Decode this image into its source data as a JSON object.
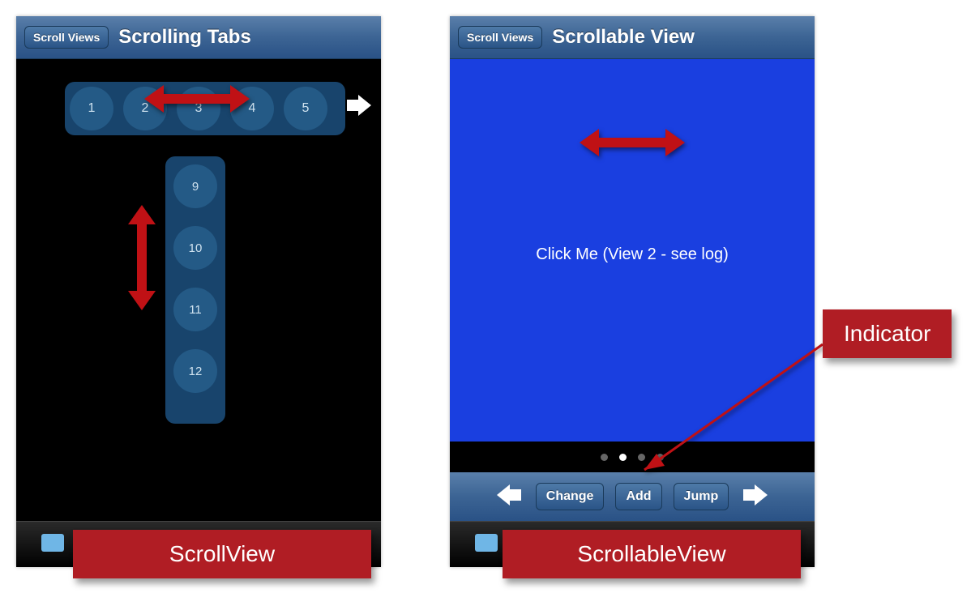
{
  "phone1": {
    "backLabel": "Scroll Views",
    "title": "Scrolling Tabs",
    "hTabs": [
      "1",
      "2",
      "3",
      "4",
      "5"
    ],
    "vTabs": [
      "9",
      "10",
      "11",
      "12"
    ]
  },
  "phone2": {
    "backLabel": "Scroll Views",
    "title": "Scrollable View",
    "clickText": "Click Me (View 2 - see log)",
    "pageCount": 4,
    "activePage": 1,
    "buttons": {
      "change": "Change",
      "add": "Add",
      "jump": "Jump"
    }
  },
  "labels": {
    "scrollView": "ScrollView",
    "scrollableView": "ScrollableView",
    "indicator": "Indicator"
  },
  "colors": {
    "accentRed": "#b01d24",
    "arrowRed": "#c01115",
    "navBlue": "#3c6494",
    "viewBlue": "#1a3fe0"
  }
}
